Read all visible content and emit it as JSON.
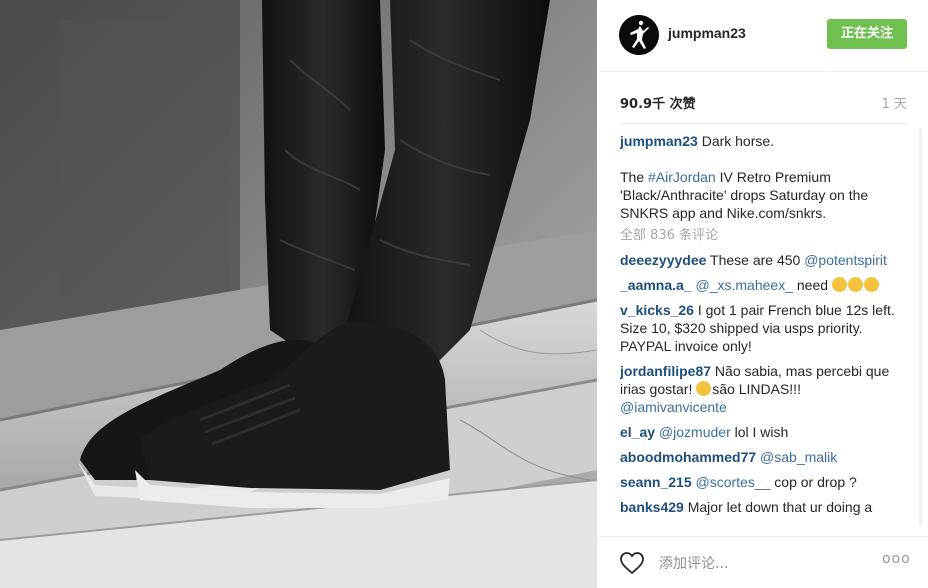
{
  "header": {
    "username": "jumpman23",
    "follow_label": "正在关注"
  },
  "stats": {
    "likes": "90.9千 次赞",
    "time": "1 天"
  },
  "caption": {
    "user": "jumpman23",
    "line1": " Dark horse.",
    "pre": "The ",
    "hashtag": "#AirJordan",
    "post": " IV Retro Premium 'Black/Anthracite' drops Saturday on the SNKRS app and Nike.com/snkrs."
  },
  "all_comments": "全部 836 条评论",
  "comments": [
    {
      "user": "deeezyyydee",
      "text": " These are 450 ",
      "mention": "@potentspirit",
      "after": ""
    },
    {
      "user": "_aamna.a_",
      "mention_first": " @_xs.maheex_",
      "text": " need "
    },
    {
      "user": "v_kicks_26",
      "text": " I got 1 pair French blue 12s left. Size 10, $320 shipped via usps priority. PAYPAL invoice only!"
    },
    {
      "user": "jordanfilipe87",
      "text": " Não sabia, mas percebi que irias gostar! ",
      "text2": "são LINDAS!!! ",
      "mention": "@iamivanvicente"
    },
    {
      "user": "el_ay",
      "mention_first": " @jozmuder",
      "text": " lol I wish"
    },
    {
      "user": "aboodmohammed77",
      "mention_first": " @sab_malik",
      "text": ""
    },
    {
      "user": "seann_215",
      "mention_first": " @scortes__",
      "text": " cop or drop ?"
    },
    {
      "user": "banks429",
      "text": " Major let down that ur doing a"
    }
  ],
  "footer": {
    "add_comment_placeholder": "添加评论...",
    "more_label": "ooo"
  },
  "icons": {
    "avatar": "jumpman-logo-icon",
    "like": "heart-icon",
    "more": "more-options-icon",
    "emoji": "crying-face-icon"
  },
  "colors": {
    "follow_button": "#70c050",
    "username_link": "#1e4f7f",
    "muted": "#a5a7aa"
  }
}
